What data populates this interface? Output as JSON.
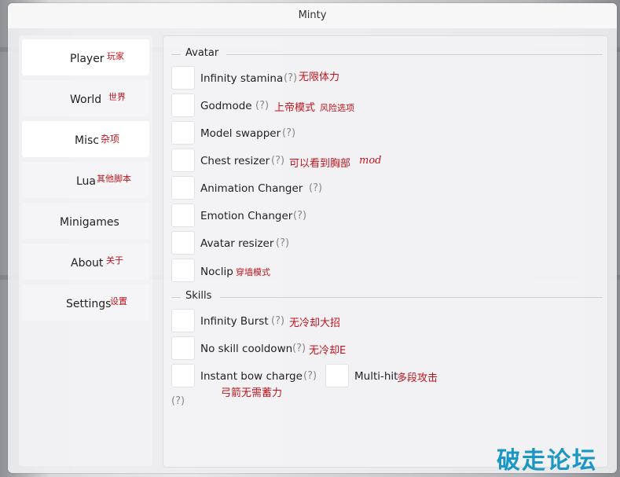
{
  "window": {
    "title": "Minty"
  },
  "sidebar": {
    "items": [
      {
        "label": "Player",
        "note": "玩家"
      },
      {
        "label": "World",
        "note": "世界"
      },
      {
        "label": "Misc",
        "note": "杂项"
      },
      {
        "label": "Lua",
        "note": "其他脚本"
      },
      {
        "label": "Minigames",
        "note": ""
      },
      {
        "label": "About",
        "note": "关于"
      },
      {
        "label": "Settings",
        "note": "设置"
      }
    ]
  },
  "avatar": {
    "title": "Avatar",
    "options": [
      {
        "label": "Infinity stamina",
        "help": "(?)",
        "note": "无限体力"
      },
      {
        "label": "Godmode",
        "help": "(?)",
        "note": "上帝模式",
        "note2": "风险选项"
      },
      {
        "label": "Model swapper",
        "help": "(?)"
      },
      {
        "label": "Chest resizer",
        "help": "(?)",
        "note": "可以看到胸部",
        "note2": "mod"
      },
      {
        "label": "Animation Changer",
        "help": "(?)"
      },
      {
        "label": "Emotion Changer",
        "help": "(?)"
      },
      {
        "label": "Avatar resizer",
        "help": "(?)"
      },
      {
        "label": "Noclip",
        "note": "穿墙模式"
      }
    ]
  },
  "skills": {
    "title": "Skills",
    "options": [
      {
        "label": "Infinity Burst",
        "help": "(?)",
        "note": "无冷却大招"
      },
      {
        "label": "No skill cooldown",
        "help": "(?)",
        "note": "无冷却E"
      },
      {
        "label": "Instant bow charge",
        "help": "(?)",
        "note": "弓箭无需蓄力"
      },
      {
        "label": "Multi-hit",
        "note": "多段攻击"
      }
    ],
    "trailing_help": "(?)"
  },
  "watermark": "破走论坛",
  "colors": {
    "annotation": "#c0141c",
    "watermark": "#1a97c5"
  }
}
